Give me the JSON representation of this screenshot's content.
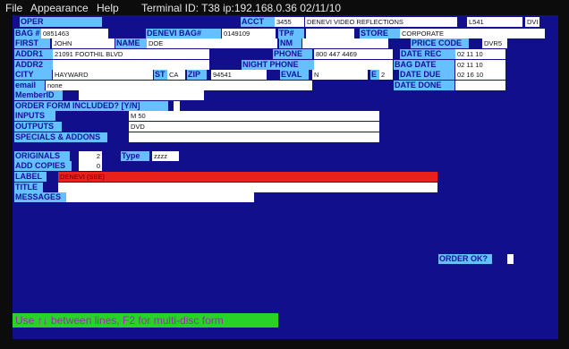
{
  "menu": {
    "file": "File",
    "appearance": "Appearance",
    "help": "Help",
    "terminal": "Terminal ID: T38 ip:192.168.0.36 02/11/10"
  },
  "labels": {
    "oper": "OPER",
    "acct": "ACCT",
    "bag": "BAG #",
    "denevi_bag": "DENEVI BAG#",
    "tp": "TP#",
    "store": "STORE",
    "first": "FIRST",
    "name": "NAME",
    "nm": "NM",
    "price_code": "PRICE CODE",
    "addr1": "ADDR1",
    "phone": "PHONE",
    "date_rec": "DATE REC",
    "addr2": "ADDR2",
    "night_phone": "NIGHT PHONE",
    "bag_date": "BAG DATE",
    "city": "CITY",
    "st": "ST",
    "zip": "ZIP",
    "eval": "EVAL",
    "e": "E",
    "date_due": "DATE DUE",
    "email": "email",
    "date_done": "DATE DONE",
    "member_id": "MemberID",
    "order_form": "ORDER FORM INCLUDED? [Y/N]",
    "inputs": "INPUTS",
    "outputs": "OUTPUTS",
    "specials": "SPECIALS & ADDONS",
    "originals": "ORIGINALS",
    "type": "Type",
    "add_copies": "ADD COPIES",
    "label": "LABEL",
    "title": "TITLE",
    "messages": "MESSAGES",
    "order_ok": "ORDER OK?"
  },
  "values": {
    "acct": "3455",
    "company": "DENEVI VIDEO REFLECTIONS",
    "acct_code": "L541",
    "acct_ext": "DVI",
    "bag": "0851463",
    "denevi_bag": "0149109",
    "tp": "",
    "store": "CORPORATE",
    "first": "JOHN",
    "name": "DOE",
    "nm": "",
    "price_code": "DVR5",
    "addr1": "21091 FOOTHIL BLVD",
    "phone": "800 447 4469",
    "date_rec": "02 11 10",
    "addr2": "",
    "night_phone": "",
    "bag_date": "02 11 10",
    "city": "HAYWARD",
    "st": "CA",
    "zip": "94541",
    "eval": "N",
    "e": "2",
    "date_due": "02 16 10",
    "email": "none",
    "date_done": "",
    "member_id": "",
    "order_form": "",
    "inputs": "M 50",
    "outputs": "DVD",
    "specials": "",
    "originals": "2",
    "type": "zzzz",
    "add_copies": "0",
    "label": "DENEVI (SEE)",
    "title": "",
    "messages": "",
    "order_ok": ""
  },
  "status": "Use ↑↓ between lines, F2 for multi-disc form",
  "colors": {
    "screen": "#120f8c",
    "label_bg": "#66c0ff",
    "label_text": "#1210a0",
    "status_bg": "#27d327",
    "status_text": "#8f38a8",
    "red_field": "#e8211b"
  }
}
